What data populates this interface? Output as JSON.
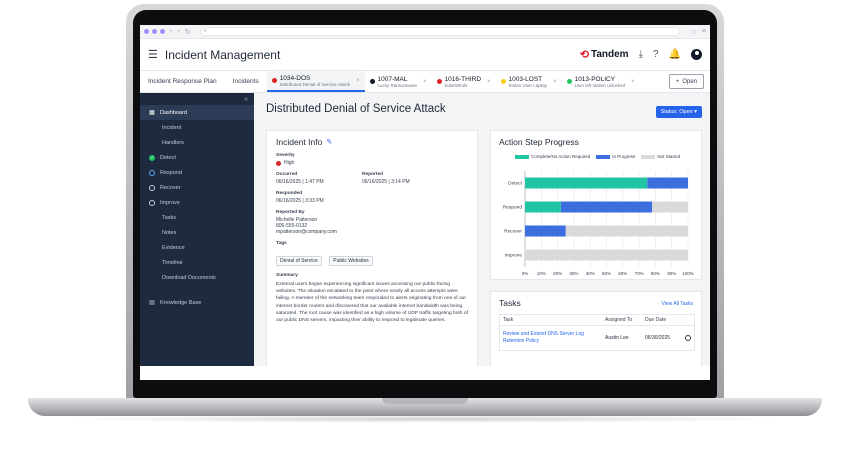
{
  "browser": {
    "url_icon": "search-icon"
  },
  "header": {
    "title": "Incident Management",
    "brand": "Tandem"
  },
  "nav": {
    "plan": "Incident Response Plan",
    "incidents": "Incidents",
    "open_label": "Open"
  },
  "tabs": [
    {
      "id": "1034-DOS",
      "sub": "Distributed Denial of Service Attack",
      "sev_color": "#dc2626",
      "active": true
    },
    {
      "id": "1007-MAL",
      "sub": "Lucky Ransomware",
      "sev_color": "#111827"
    },
    {
      "id": "1016-THIRD",
      "sub": "SolarWinds",
      "sev_color": "#dc2626"
    },
    {
      "id": "1003-LOST",
      "sub": "Stolen User Laptop",
      "sev_color": "#facc15"
    },
    {
      "id": "1013-POLICY",
      "sub": "User left station unlocked",
      "sev_color": "#22c55e"
    }
  ],
  "sidebar": {
    "dashboard": "Dashboard",
    "incident": "Incident",
    "handlers": "Handlers",
    "detect": "Detect",
    "respond": "Respond",
    "recover": "Recover",
    "improve": "Improve",
    "tasks": "Tasks",
    "notes": "Notes",
    "evidence": "Evidence",
    "timeline": "Timeline",
    "downloads": "Download Documents",
    "kb": "Knowledge Base"
  },
  "page": {
    "title": "Distributed Denial of Service Attack",
    "status": "Status: Open"
  },
  "info": {
    "title": "Incident Info",
    "severity_label": "Severity",
    "severity": "High",
    "occurred_label": "Occurred",
    "occurred": "06/16/2025 | 1:47 PM",
    "reported_label": "Reported",
    "reported": "06/16/2025 | 3:14 PM",
    "responded_label": "Responded",
    "responded": "06/16/2025 | 3:33 PM",
    "reported_by_label": "Reported By",
    "reporter_name": "Michelle Patterson",
    "reporter_phone": "806-555-0132",
    "reporter_email": "mpatterson@company.com",
    "tags_label": "Tags",
    "tags": [
      "Denial of Service",
      "Public Websites"
    ],
    "summary_label": "Summary",
    "summary": "External users began experiencing significant issues accessing our public-facing websites. The situation escalated to the point where nearly all access attempts were failing. A member of the networking team responded to alerts originating from one of our internet border routers and discovered that our available internet bandwidth was being saturated. The root cause was identified as a high volume of UDP traffic targeting both of our public DNS servers, impacting their ability to respond to legitimate queries."
  },
  "progress_card": {
    "title": "Action Step Progress"
  },
  "chart_data": {
    "type": "bar",
    "orientation": "horizontal",
    "stacked": true,
    "categories": [
      "Detect",
      "Respond",
      "Recover",
      "Improve"
    ],
    "series": [
      {
        "name": "Complete/No Action Required",
        "color": "#22c5a3",
        "values": [
          75,
          22,
          0,
          0
        ]
      },
      {
        "name": "In Progress",
        "color": "#3b6fe0",
        "values": [
          25,
          56,
          25,
          0
        ]
      },
      {
        "name": "Not Started",
        "color": "#d9d9d9",
        "values": [
          0,
          22,
          75,
          100
        ]
      }
    ],
    "xlim": [
      0,
      100
    ],
    "xticks": [
      "0%",
      "10%",
      "20%",
      "30%",
      "40%",
      "50%",
      "60%",
      "70%",
      "80%",
      "90%",
      "100%"
    ],
    "grid": true,
    "legend": "top"
  },
  "tasks": {
    "title": "Tasks",
    "view_all": "View All Tasks",
    "col_task": "Task",
    "col_assigned": "Assigned To",
    "col_due": "Due Date",
    "rows": [
      {
        "task": "Review and Extend DNS Server Log Retention Policy",
        "assigned": "Austin Lee",
        "due": "06/30/2025"
      }
    ]
  }
}
